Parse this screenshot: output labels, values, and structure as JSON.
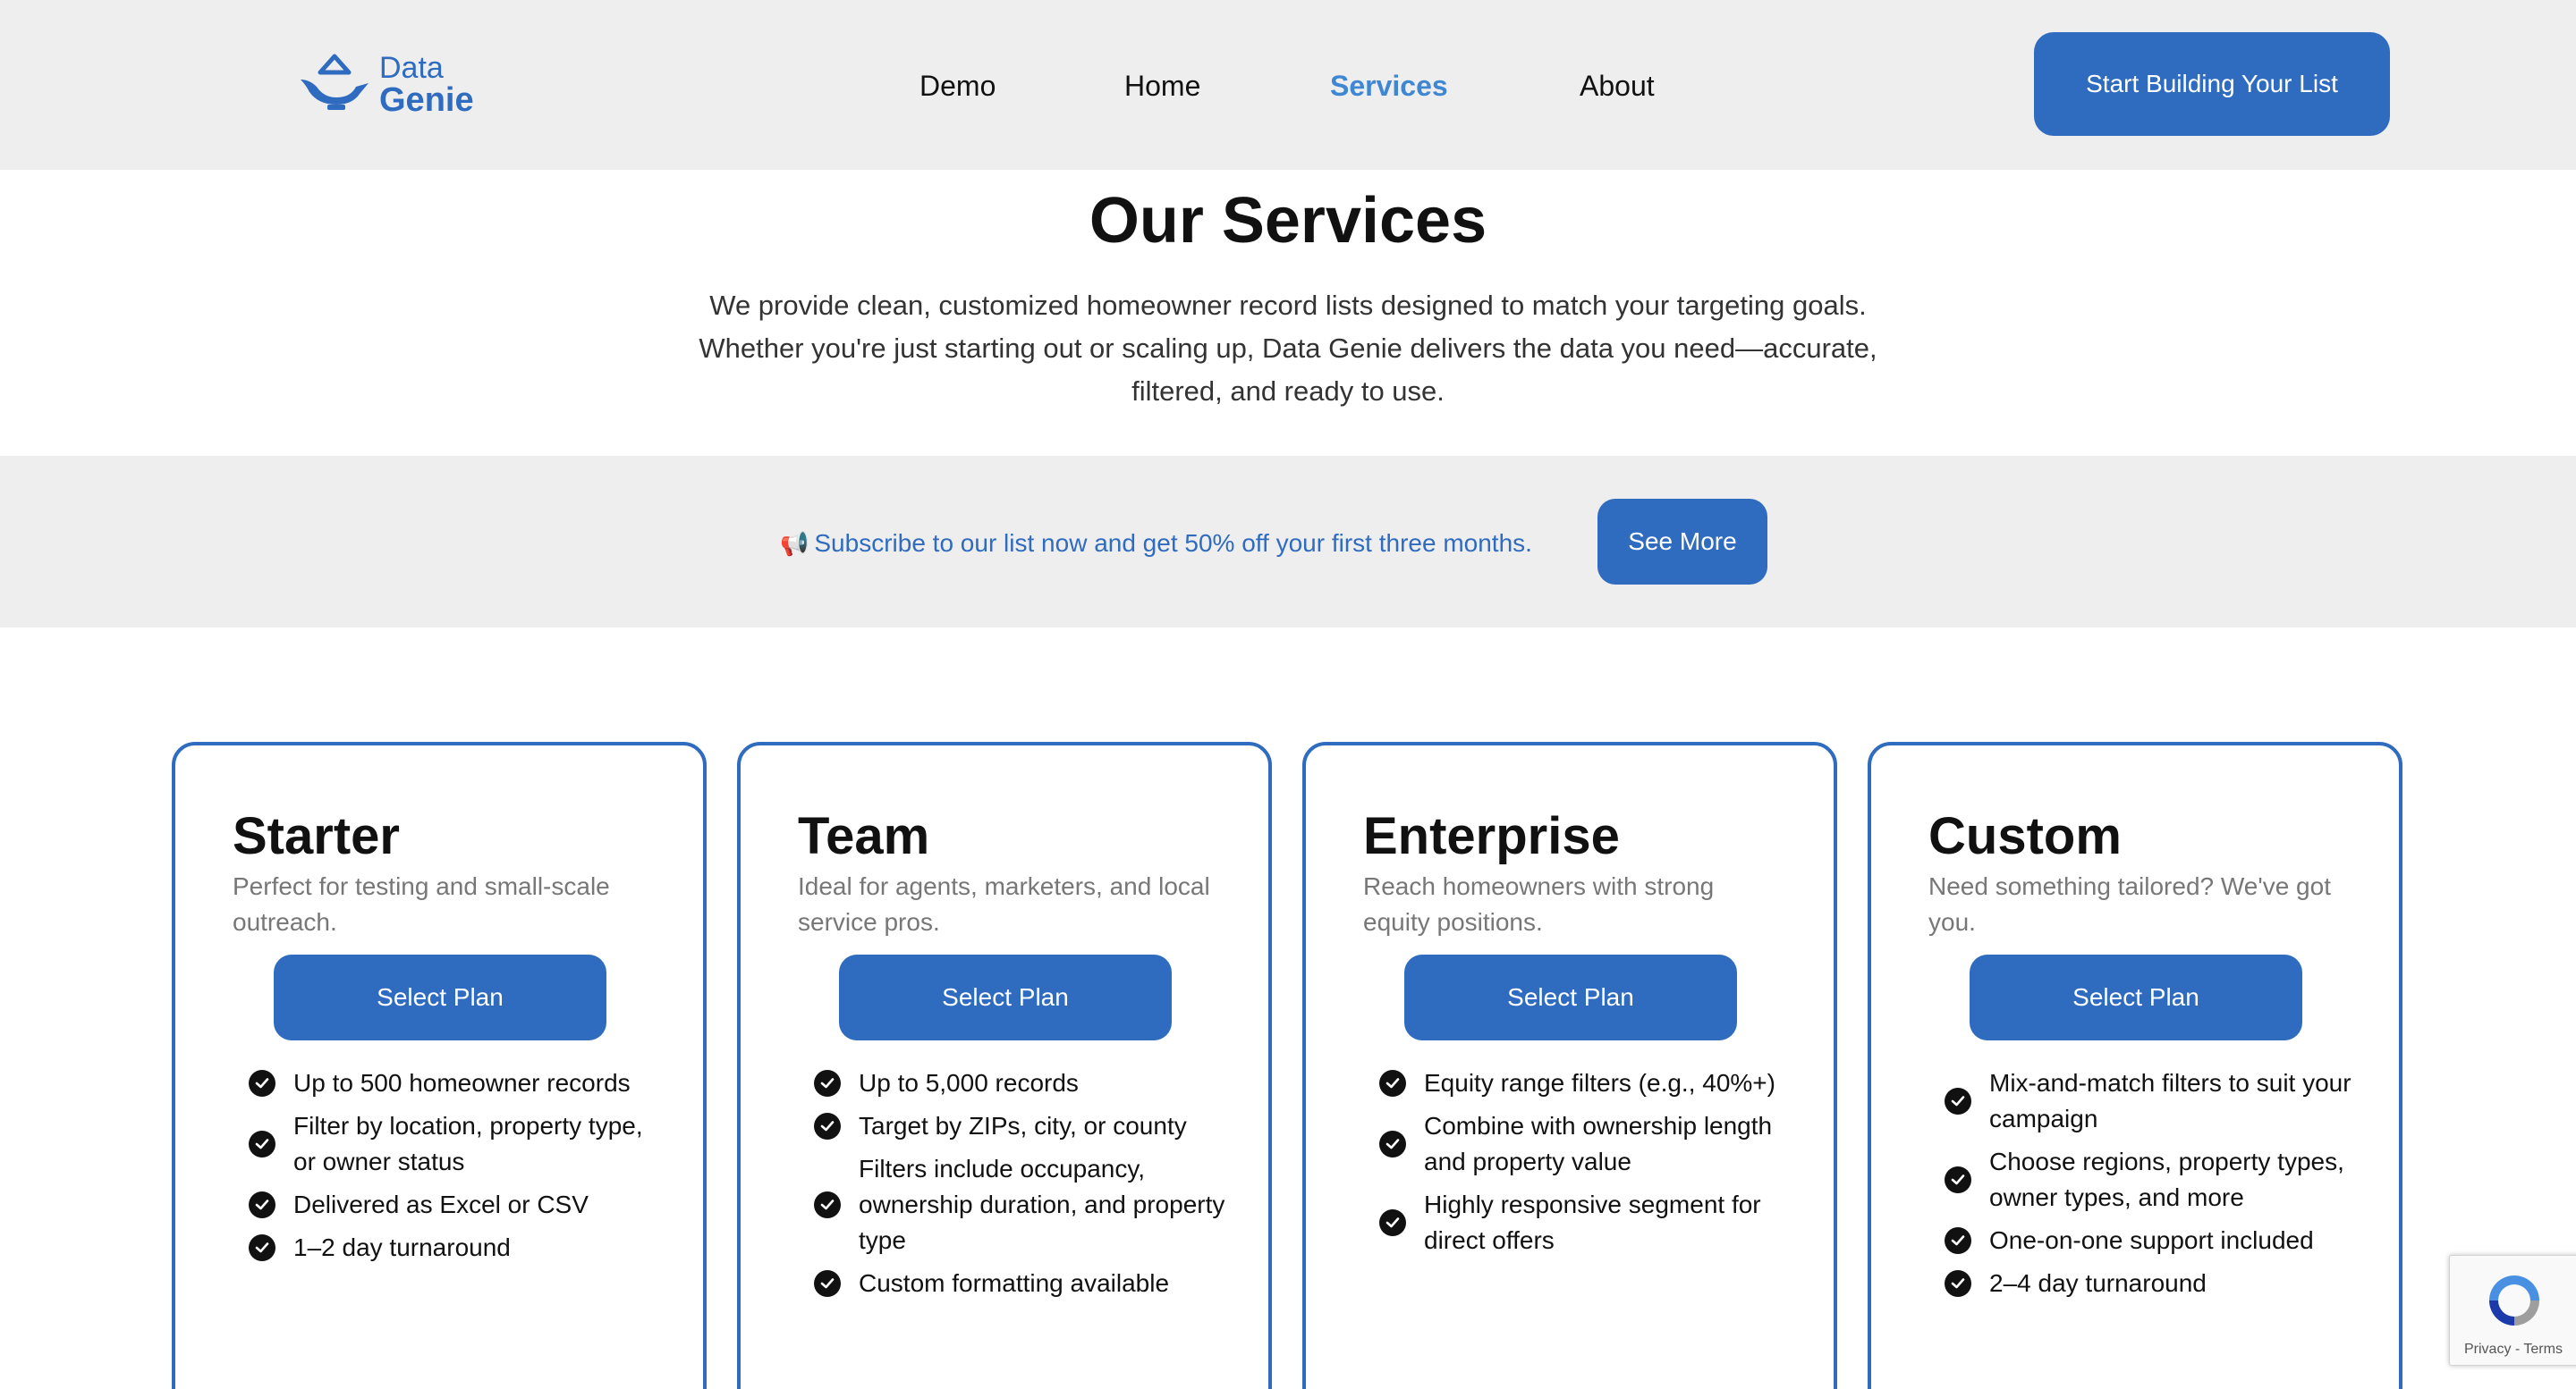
{
  "header": {
    "logo": {
      "line1": "Data",
      "line2": "Genie",
      "icon": "genie-lamp-icon"
    },
    "nav": [
      "Demo",
      "Home",
      "Services",
      "About"
    ],
    "active_nav": "Services",
    "cta_label": "Start Building Your List"
  },
  "intro": {
    "title": "Our Services",
    "description": "We provide clean, customized homeowner record lists designed to match your targeting goals. Whether you're just starting out or scaling up, Data Genie delivers the data you need—accurate, filtered, and ready to use."
  },
  "promo": {
    "icon": "megaphone-icon",
    "text": "Subscribe to our list now and get 50% off your first three months.",
    "button_label": "See More"
  },
  "plans": [
    {
      "name": "Starter",
      "subtitle": "Perfect for testing and small-scale outreach.",
      "button_label": "Select Plan",
      "features": [
        "Up to 500 homeowner records",
        "Filter by location, property type, or owner status",
        "Delivered as Excel or CSV",
        "1–2 day turnaround"
      ]
    },
    {
      "name": "Team",
      "subtitle": "Ideal for agents, marketers, and local service pros.",
      "button_label": "Select Plan",
      "features": [
        "Up to 5,000 records",
        "Target by ZIPs, city, or county",
        "Filters include occupancy, ownership duration, and property type",
        "Custom formatting available"
      ]
    },
    {
      "name": "Enterprise",
      "subtitle": "Reach homeowners with strong equity positions.",
      "button_label": "Select Plan",
      "features": [
        "Equity range filters (e.g., 40%+)",
        "Combine with ownership length and property value",
        "Highly responsive segment for direct offers"
      ]
    },
    {
      "name": "Custom",
      "subtitle": "Need something tailored? We've got you.",
      "button_label": "Select Plan",
      "features": [
        "Mix-and-match filters to suit your campaign",
        "Choose regions, property types, owner types, and more",
        "One-on-one support included",
        "2–4 day turnaround"
      ]
    }
  ],
  "recaptcha": {
    "text": "Privacy - Terms"
  },
  "colors": {
    "brand": "#2f6bbf",
    "nav_active": "#3f87d2",
    "band_bg": "#eeeeef"
  }
}
